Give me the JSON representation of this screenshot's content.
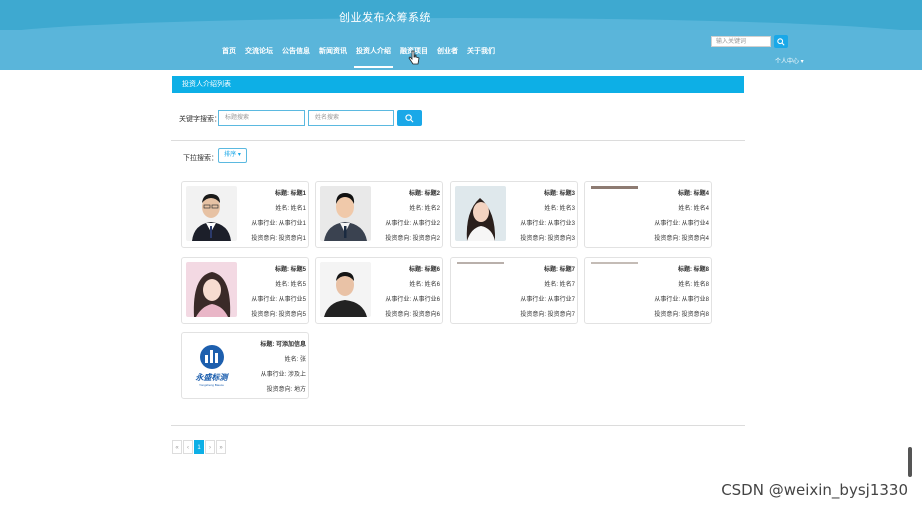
{
  "header": {
    "site_title": "创业发布众筹系统",
    "nav": [
      {
        "label": "首页"
      },
      {
        "label": "交流论坛"
      },
      {
        "label": "公告信息"
      },
      {
        "label": "新闻资讯"
      },
      {
        "label": "投资人介绍",
        "active": true
      },
      {
        "label": "融资项目"
      },
      {
        "label": "创业者"
      },
      {
        "label": "关于我们"
      }
    ],
    "search_placeholder": "输入关键词",
    "user_menu": "个人中心 ▾"
  },
  "section": {
    "title": "投资人介绍列表"
  },
  "filters": {
    "keyword_label": "关键字搜索：",
    "title_placeholder": "标题搜索",
    "name_placeholder": "姓名搜索",
    "dropdown_label": "下拉搜索：",
    "sort_label": "排序 ▾"
  },
  "cards": [
    {
      "title": "标题: 标题1",
      "name": "姓名: 姓名1",
      "industry": "从事行业: 从事行业1",
      "direction": "投资意向: 投资意向1",
      "photo": "man-suit"
    },
    {
      "title": "标题: 标题2",
      "name": "姓名: 姓名2",
      "industry": "从事行业: 从事行业2",
      "direction": "投资意向: 投资意向2",
      "photo": "man-suit"
    },
    {
      "title": "标题: 标题3",
      "name": "姓名: 姓名3",
      "industry": "从事行业: 从事行业3",
      "direction": "投资意向: 投资意向3",
      "photo": "woman"
    },
    {
      "title": "标题: 标题4",
      "name": "姓名: 姓名4",
      "industry": "从事行业: 从事行业4",
      "direction": "投资意向: 投资意向4",
      "photo": "blank"
    },
    {
      "title": "标题: 标题5",
      "name": "姓名: 姓名5",
      "industry": "从事行业: 从事行业5",
      "direction": "投资意向: 投资意向5",
      "photo": "woman-pink"
    },
    {
      "title": "标题: 标题6",
      "name": "姓名: 姓名6",
      "industry": "从事行业: 从事行业6",
      "direction": "投资意向: 投资意向6",
      "photo": "man-casual"
    },
    {
      "title": "标题: 标题7",
      "name": "姓名: 姓名7",
      "industry": "从事行业: 从事行业7",
      "direction": "投资意向: 投资意向7",
      "photo": "blank"
    },
    {
      "title": "标题: 标题8",
      "name": "姓名: 姓名8",
      "industry": "从事行业: 从事行业8",
      "direction": "投资意向: 投资意向8",
      "photo": "blank"
    },
    {
      "title": "标题: 可添加信息",
      "name": "姓名: 张",
      "industry": "从事行业: 涉及上",
      "direction": "投资意向: 地方",
      "photo": "logo",
      "logo_text": "永盛标测",
      "logo_subtext": "Yongsheng Biaoce"
    }
  ],
  "pagination": {
    "first": "«",
    "prev": "‹",
    "current": "1",
    "next": "›",
    "last": "»"
  },
  "watermark": "CSDN @weixin_bysj1330",
  "colors": {
    "header": "#3ea9d0",
    "accent": "#0dafe6",
    "button": "#1aa8e8"
  }
}
